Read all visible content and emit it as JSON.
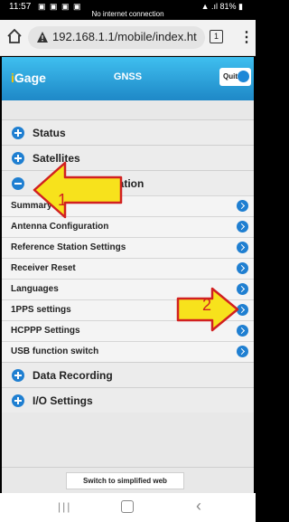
{
  "status_bar": {
    "time": "11:57",
    "left_icons": "▣ ▣ ▣ ▣",
    "network_notice": "No internet connection",
    "battery": "81%"
  },
  "browser": {
    "url": "192.168.1.1/mobile/index.ht",
    "tab_count": "1"
  },
  "app": {
    "logo_prefix": "i",
    "logo_text": "Gage",
    "title": "GNSS",
    "quit_label": "Quit"
  },
  "sections": {
    "status": "Status",
    "satellites": "Satellites",
    "receiver_configuration": "ration",
    "data_recording": "Data Recording",
    "io_settings": "I/O Settings"
  },
  "items": [
    {
      "label": "Summary"
    },
    {
      "label": "Antenna Configuration"
    },
    {
      "label": "Reference Station Settings"
    },
    {
      "label": "Receiver Reset"
    },
    {
      "label": "Languages"
    },
    {
      "label": "1PPS settings"
    },
    {
      "label": "HCPPP Settings"
    },
    {
      "label": "USB function switch"
    }
  ],
  "bottom": {
    "simplified_label": "Switch to simplified web"
  },
  "annotations": {
    "arrow1_number": "1",
    "arrow2_number": "2",
    "arrow_fill": "#f7e21c",
    "arrow_stroke": "#d12020"
  },
  "colors": {
    "header_top": "#3fbfef",
    "header_bottom": "#1e88c7",
    "accent_blue": "#1f7fd1"
  }
}
